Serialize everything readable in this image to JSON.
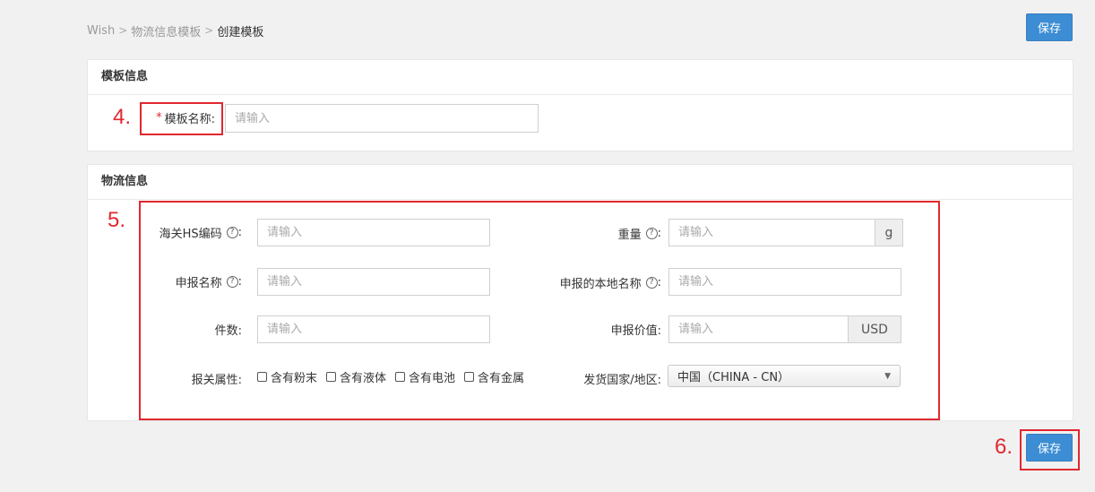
{
  "breadcrumb": {
    "item1": "Wish",
    "item2": "物流信息模板",
    "current": "创建模板",
    "separator": ">"
  },
  "header": {
    "save_label": "保存"
  },
  "template_info": {
    "title": "模板信息",
    "required_mark": "*",
    "name_label": "模板名称:",
    "name_placeholder": "请输入"
  },
  "logistics_info": {
    "title": "物流信息",
    "hs_code_label": "海关HS编码",
    "hs_code_placeholder": "请输入",
    "weight_label": "重量",
    "weight_placeholder": "请输入",
    "weight_unit": "g",
    "declare_name_label": "申报名称",
    "declare_name_placeholder": "请输入",
    "local_name_label": "申报的本地名称",
    "local_name_placeholder": "请输入",
    "count_label": "件数:",
    "count_placeholder": "请输入",
    "declare_value_label": "申报价值:",
    "declare_value_placeholder": "请输入",
    "currency": "USD",
    "customs_attr_label": "报关属性:",
    "attributes": [
      "含有粉末",
      "含有液体",
      "含有电池",
      "含有金属"
    ],
    "country_label": "发货国家/地区:",
    "country_value": "中国（CHINA - CN）",
    "colon": ":",
    "help_mark": "?"
  },
  "annotations": {
    "a4": "4.",
    "a5": "5.",
    "a6": "6."
  },
  "footer": {
    "save_label": "保存"
  },
  "colors": {
    "primary": "#3c8dd3",
    "annotation_red": "#e0282f",
    "background": "#f1f1f1"
  },
  "icons": {
    "help": "question-circle-icon",
    "dropdown": "triangle-down-icon"
  }
}
